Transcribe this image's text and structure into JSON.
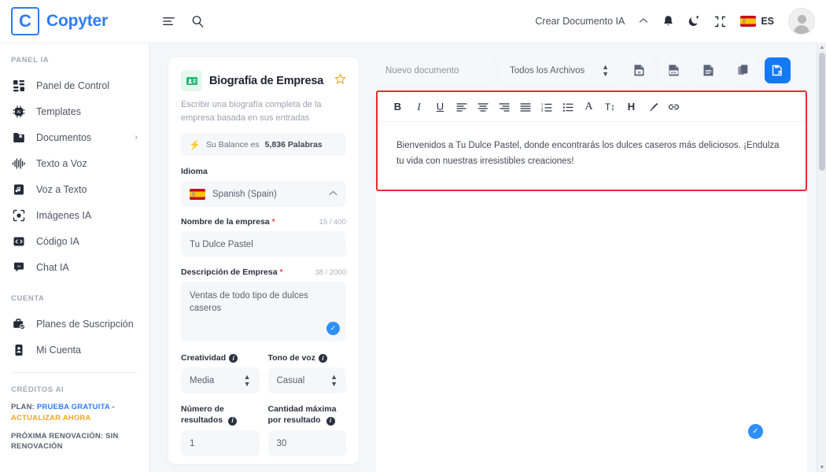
{
  "brand": {
    "logo_letter": "C",
    "name": "Copyter"
  },
  "topbar": {
    "menu_icon": "list-icon",
    "search_icon": "search-icon",
    "create_document_label": "Crear Documento IA",
    "caret_icon": "chevron-up-icon",
    "bell_icon": "bell-icon",
    "dark_mode_icon": "moon-icon",
    "fullscreen_icon": "collapse-icon",
    "language_code": "ES",
    "avatar_icon": "user-avatar"
  },
  "sidebar": {
    "section_panel_label": "PANEL IA",
    "items": [
      {
        "label": "Panel de Control",
        "icon": "dashboard-icon",
        "chevron": ""
      },
      {
        "label": "Templates",
        "icon": "chip-icon",
        "chevron": ""
      },
      {
        "label": "Documentos",
        "icon": "folder-bookmark-icon",
        "chevron": "›"
      },
      {
        "label": "Texto a Voz",
        "icon": "waveform-icon",
        "chevron": ""
      },
      {
        "label": "Voz a Texto",
        "icon": "audio-file-icon",
        "chevron": ""
      },
      {
        "label": "Imágenes IA",
        "icon": "camera-frame-icon",
        "chevron": ""
      },
      {
        "label": "Código IA",
        "icon": "code-icon",
        "chevron": ""
      },
      {
        "label": "Chat IA",
        "icon": "chat-icon",
        "chevron": ""
      }
    ],
    "section_account_label": "CUENTA",
    "account_items": [
      {
        "label": "Planes de Suscripción",
        "icon": "briefcase-check-icon"
      },
      {
        "label": "Mi Cuenta",
        "icon": "id-card-icon"
      }
    ],
    "section_credits_label": "CRÉDITOS AI",
    "plan_prefix": "PLAN:",
    "plan_value": "PRUEBA GRATUITA",
    "plan_sep": "-",
    "plan_action": "ACTUALIZAR AHORA",
    "renewal_text": "PRÓXIMA RENOVACIÓN: SIN RENOVACIÓN"
  },
  "form": {
    "badge_icon": "contact-card-icon",
    "title": "Biografía de Empresa",
    "star_icon": "star-icon",
    "description": "Escribir una biografía completa de la empresa basada en sus entradas",
    "balance_icon": "bolt-icon",
    "balance_prefix": "Su Balance es",
    "balance_value": "5,836 Palabras",
    "language_label": "Idioma",
    "language_value": "Spanish (Spain)",
    "language_chevron": "chevron-up-icon",
    "company_name_label": "Nombre de la empresa",
    "company_name_count": "15 / 400",
    "company_name_value": "Tu Dulce Pastel",
    "description_label": "Descripción de Empresa",
    "description_count": "38 / 2000",
    "description_value": "Ventas de todo tipo de dulces caseros",
    "check_icon": "check-icon",
    "creativity_label": "Creatividad",
    "creativity_value": "Media",
    "tone_label": "Tono de voz",
    "tone_value": "Casual",
    "results_label": "Número de resultados",
    "results_value": "1",
    "max_amount_label": "Cantidad máxima por resultado",
    "max_amount_value": "30",
    "info_icon": "info-icon"
  },
  "editor": {
    "doc_name_placeholder": "Nuevo documento",
    "files_filter_value": "Todos los Archivos",
    "export_buttons": [
      {
        "name": "export-word-button",
        "label": "W"
      },
      {
        "name": "export-pdf-button",
        "label": "PDF"
      },
      {
        "name": "export-text-button",
        "label": ""
      },
      {
        "name": "copy-button",
        "label": ""
      },
      {
        "name": "save-document-button",
        "label": ""
      }
    ],
    "toolbar_buttons": [
      {
        "name": "bold-button",
        "glyph": "B"
      },
      {
        "name": "italic-button",
        "glyph": "I"
      },
      {
        "name": "underline-button",
        "glyph": "U"
      },
      {
        "name": "align-left-button",
        "glyph": "align-left-icon"
      },
      {
        "name": "align-center-button",
        "glyph": "align-center-icon"
      },
      {
        "name": "align-right-button",
        "glyph": "align-right-icon"
      },
      {
        "name": "align-justify-button",
        "glyph": "align-justify-icon"
      },
      {
        "name": "ordered-list-button",
        "glyph": "ordered-list-icon"
      },
      {
        "name": "unordered-list-button",
        "glyph": "unordered-list-icon"
      },
      {
        "name": "font-color-button",
        "glyph": "A"
      },
      {
        "name": "font-size-button",
        "glyph": "T↕"
      },
      {
        "name": "heading-button",
        "glyph": "H"
      },
      {
        "name": "highlight-button",
        "glyph": "brush-icon"
      },
      {
        "name": "link-button",
        "glyph": "link-icon"
      }
    ],
    "content": "Bienvenidos a Tu Dulce Pastel, donde encontrarás los dulces caseros más deliciosos. ¡Endulza tu vida con nuestras irresistibles creaciones!",
    "status_check_icon": "check-icon"
  },
  "colors": {
    "accent_blue": "#2e7cf6",
    "primary_button": "#1479f5",
    "highlight_border": "#ee2b2b",
    "page_bg": "#f4f6fa",
    "star_orange": "#f5a623",
    "required_red": "#ef4444"
  }
}
